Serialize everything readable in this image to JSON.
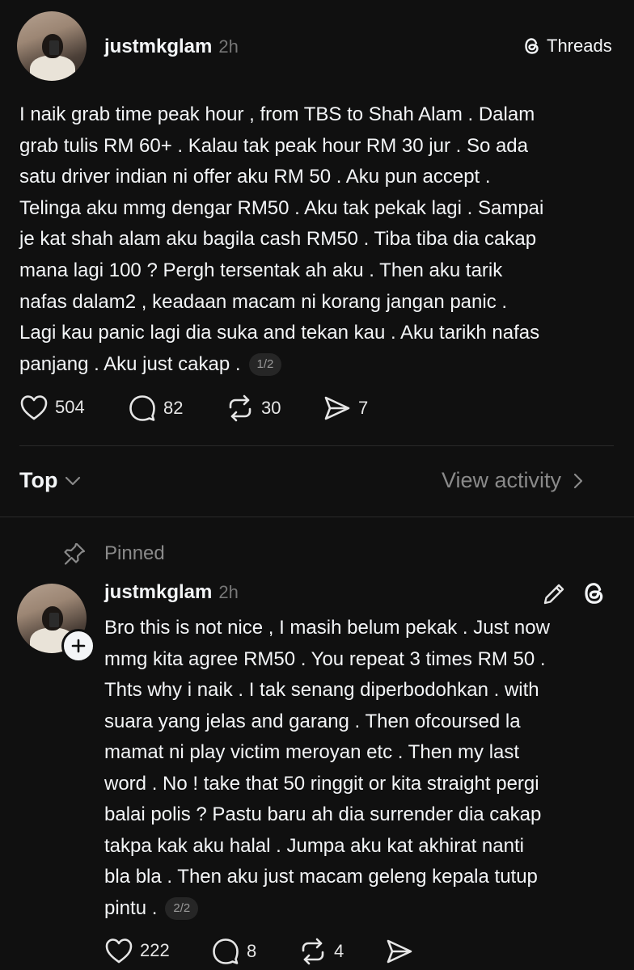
{
  "post": {
    "username": "justmkglam",
    "time": "2h",
    "brand": "Threads",
    "text": "I naik grab time peak hour , from TBS to Shah Alam . Dalam\ngrab tulis RM 60+ . Kalau tak peak hour  RM 30 jur . So ada\nsatu driver indian ni offer aku RM 50 . Aku pun accept .\nTelinga aku mmg dengar RM50 . Aku tak pekak lagi . Sampai\nje kat shah alam aku bagila cash RM50 . Tiba tiba dia cakap\nmana lagi 100 ? Pergh tersentak ah aku . Then aku tarik\nnafas dalam2 ,  keadaan macam ni korang jangan panic .\nLagi kau panic lagi dia suka and tekan kau . Aku tarikh nafas\npanjang . Aku just cakap .",
    "pager": "1/2",
    "likes": "504",
    "replies": "82",
    "reposts": "30",
    "shares": "7"
  },
  "sort": {
    "label": "Top",
    "view_activity": "View activity"
  },
  "reply": {
    "pinned_label": "Pinned",
    "username": "justmkglam",
    "time": "2h",
    "text": "Bro this is not nice , I masih belum pekak . Just now\nmmg kita agree RM50 . You repeat 3 times RM 50 .\nThts why i naik . I tak senang diperbodohkan . with\nsuara yang jelas and garang . Then ofcoursed la\nmamat ni play victim meroyan etc . Then my last\nword . No ! take that 50 ringgit or kita straight pergi\nbalai polis ? Pastu baru ah dia surrender dia cakap\ntakpa kak aku halal . Jumpa aku kat akhirat nanti\nbla bla . Then aku just macam geleng kepala tutup\npintu .",
    "pager": "2/2",
    "likes": "222",
    "replies": "8",
    "reposts": "4"
  },
  "icons": {
    "threads": "threads-logo-icon",
    "heart": "heart-icon",
    "comment": "comment-icon",
    "repost": "repost-icon",
    "share": "send-icon",
    "chevron_down": "chevron-down-icon",
    "chevron_right": "chevron-right-icon",
    "pin": "pin-icon",
    "edit": "pencil-icon",
    "plus": "plus-icon"
  },
  "colors": {
    "background": "#101010",
    "text": "#f3f5f7",
    "muted": "#777777"
  }
}
